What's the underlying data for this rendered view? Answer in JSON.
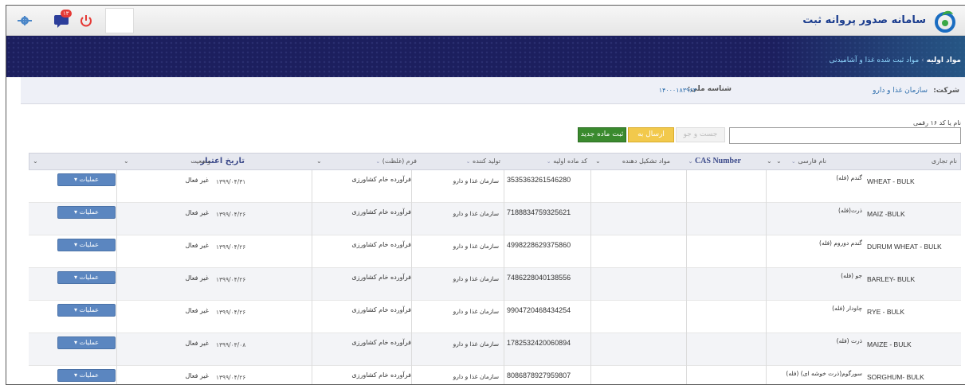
{
  "header": {
    "brand": "سامانه صدور پروانه ثبت",
    "notification_count": "۱۳"
  },
  "breadcrumb": {
    "root": "مواد اولیه",
    "current": "مواد ثبت شده غذا و آشامیدنی"
  },
  "company": {
    "label": "شرکت:",
    "name": "سازمان غذا و دارو",
    "nid_label": "شناسه ملی:",
    "nid_value": "۱۴۰۰۰۱۸۳۹۶۳"
  },
  "search": {
    "label": "نام یا کد ۱۶ رقمی",
    "value": "",
    "search_btn": "جست و جو",
    "excel_btn": "ارسال به اکسل",
    "new_btn": "ثبت ماده جدید"
  },
  "columns": {
    "trade_name": "نام تجاری",
    "persian_name": "نام فارسی",
    "cas": "CAS Number",
    "components": "مواد تشکیل دهنده",
    "code": "کد ماده اولیه",
    "producer": "تولید کننده",
    "form": "فرم (غلظت)",
    "validity": "تاریخ اعتبار",
    "status": "وضعیت"
  },
  "rows": [
    {
      "trade": "WHEAT - BULK",
      "fa": "گندم (فله)",
      "code": "3535363261546280",
      "producer": "سازمان غذا و دارو",
      "form": "فرآورده خام کشاورزی",
      "date": "۱۳۹۹/۰۴/۳۱",
      "status": "غیر فعال",
      "ops": "عملیات"
    },
    {
      "trade": "MAIZ -BULK",
      "fa": "ذرت(فله)",
      "code": "7188834759325621",
      "producer": "سازمان غذا و دارو",
      "form": "فرآورده خام کشاورزی",
      "date": "۱۳۹۹/۰۴/۲۶",
      "status": "غیر فعال",
      "ops": "عملیات"
    },
    {
      "trade": "DURUM WHEAT - BULK",
      "fa": "گندم دوروم (فله)",
      "code": "4998228629375860",
      "producer": "سازمان غذا و دارو",
      "form": "فرآورده خام کشاورزی",
      "date": "۱۳۹۹/۰۴/۲۶",
      "status": "غیر فعال",
      "ops": "عملیات"
    },
    {
      "trade": "BARLEY- BULK",
      "fa": "جو (فله)",
      "code": "7486228040138556",
      "producer": "سازمان غذا و دارو",
      "form": "فرآورده خام کشاورزی",
      "date": "۱۳۹۹/۰۴/۲۶",
      "status": "غیر فعال",
      "ops": "عملیات"
    },
    {
      "trade": "RYE - BULK",
      "fa": "چاودار (فله)",
      "code": "9904720468434254",
      "producer": "سازمان غذا و دارو",
      "form": "فرآورده خام کشاورزی",
      "date": "۱۳۹۹/۰۴/۲۶",
      "status": "غیر فعال",
      "ops": "عملیات"
    },
    {
      "trade": "MAIZE - BULK",
      "fa": "ذرت (فله)",
      "code": "1782532420060894",
      "producer": "سازمان غذا و دارو",
      "form": "فرآورده خام کشاورزی",
      "date": "۱۳۹۹/۰۳/۰۸",
      "status": "غیر فعال",
      "ops": "عملیات"
    },
    {
      "trade": "SORGHUM- BULK",
      "fa": "سورگوم(ذرت خوشه ای) (فله)",
      "code": "8086878927959807",
      "producer": "سازمان غذا و دارو",
      "form": "فرآورده خام کشاورزی",
      "date": "۱۳۹۹/۰۴/۲۶",
      "status": "غیر فعال",
      "ops": "عملیات"
    }
  ]
}
